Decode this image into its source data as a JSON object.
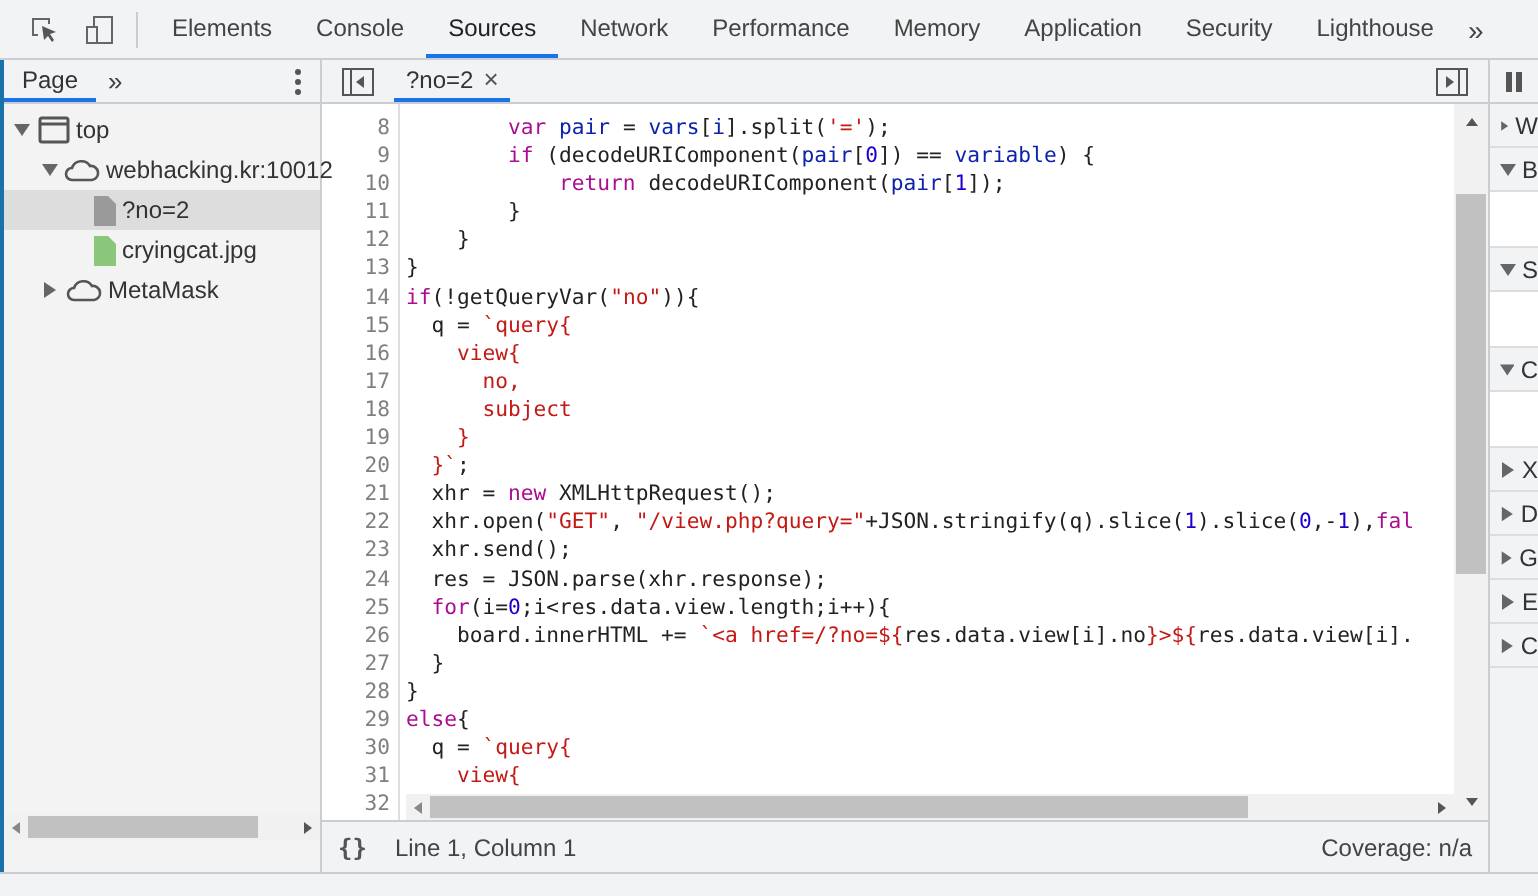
{
  "toolbar": {
    "tabs": [
      {
        "label": "Elements",
        "selected": false
      },
      {
        "label": "Console",
        "selected": false
      },
      {
        "label": "Sources",
        "selected": true
      },
      {
        "label": "Network",
        "selected": false
      },
      {
        "label": "Performance",
        "selected": false
      },
      {
        "label": "Memory",
        "selected": false
      },
      {
        "label": "Application",
        "selected": false
      },
      {
        "label": "Security",
        "selected": false
      },
      {
        "label": "Lighthouse",
        "selected": false
      }
    ],
    "more": "»"
  },
  "navigator": {
    "tabs": [
      {
        "label": "Page",
        "selected": true
      }
    ],
    "more": "»",
    "tree": [
      {
        "label": "top",
        "kind": "frame",
        "expanded": true,
        "selected": false,
        "children": [
          {
            "label": "webhacking.kr:10012",
            "kind": "cloud",
            "expanded": true,
            "selected": false,
            "children": [
              {
                "label": "?no=2",
                "kind": "doc",
                "selected": true
              },
              {
                "label": "cryingcat.jpg",
                "kind": "image",
                "selected": false
              }
            ]
          },
          {
            "label": "MetaMask",
            "kind": "cloud",
            "expanded": false,
            "selected": false
          }
        ]
      }
    ]
  },
  "editor": {
    "tabs": [
      {
        "label": "?no=2",
        "selected": true,
        "close": "×"
      }
    ],
    "lines": [
      {
        "n": "8",
        "tokens": [
          {
            "kind": "keyword",
            "text": "        var "
          },
          {
            "kind": "variable",
            "text": "pair"
          },
          {
            "kind": "plain",
            "text": " = "
          },
          {
            "kind": "variable",
            "text": "vars"
          },
          {
            "kind": "plain",
            "text": "["
          },
          {
            "kind": "variable",
            "text": "i"
          },
          {
            "kind": "plain",
            "text": "].split("
          },
          {
            "kind": "string",
            "text": "'='"
          },
          {
            "kind": "plain",
            "text": ");"
          }
        ]
      },
      {
        "n": "9",
        "tokens": [
          {
            "kind": "keyword",
            "text": "        if"
          },
          {
            "kind": "plain",
            "text": " (decodeURIComponent("
          },
          {
            "kind": "variable",
            "text": "pair"
          },
          {
            "kind": "plain",
            "text": "["
          },
          {
            "kind": "number",
            "text": "0"
          },
          {
            "kind": "plain",
            "text": "]) == "
          },
          {
            "kind": "variable",
            "text": "variable"
          },
          {
            "kind": "plain",
            "text": ") {"
          }
        ]
      },
      {
        "n": "10",
        "tokens": [
          {
            "kind": "keyword",
            "text": "            return"
          },
          {
            "kind": "plain",
            "text": " decodeURIComponent("
          },
          {
            "kind": "variable",
            "text": "pair"
          },
          {
            "kind": "plain",
            "text": "["
          },
          {
            "kind": "number",
            "text": "1"
          },
          {
            "kind": "plain",
            "text": "]);"
          }
        ]
      },
      {
        "n": "11",
        "tokens": [
          {
            "kind": "plain",
            "text": "        }"
          }
        ]
      },
      {
        "n": "12",
        "tokens": [
          {
            "kind": "plain",
            "text": "    }"
          }
        ]
      },
      {
        "n": "13",
        "tokens": [
          {
            "kind": "plain",
            "text": "}"
          }
        ]
      },
      {
        "n": "14",
        "tokens": [
          {
            "kind": "keyword",
            "text": "if"
          },
          {
            "kind": "plain",
            "text": "(!getQueryVar("
          },
          {
            "kind": "string",
            "text": "\"no\""
          },
          {
            "kind": "plain",
            "text": ")){"
          }
        ]
      },
      {
        "n": "15",
        "tokens": [
          {
            "kind": "plain",
            "text": "  q = "
          },
          {
            "kind": "string",
            "text": "`query{"
          }
        ]
      },
      {
        "n": "16",
        "tokens": [
          {
            "kind": "string",
            "text": "    view{"
          }
        ]
      },
      {
        "n": "17",
        "tokens": [
          {
            "kind": "string",
            "text": "      no,"
          }
        ]
      },
      {
        "n": "18",
        "tokens": [
          {
            "kind": "string",
            "text": "      subject"
          }
        ]
      },
      {
        "n": "19",
        "tokens": [
          {
            "kind": "string",
            "text": "    }"
          }
        ]
      },
      {
        "n": "20",
        "tokens": [
          {
            "kind": "string",
            "text": "  }`"
          },
          {
            "kind": "plain",
            "text": ";"
          }
        ]
      },
      {
        "n": "21",
        "tokens": [
          {
            "kind": "plain",
            "text": "  xhr = "
          },
          {
            "kind": "keyword",
            "text": "new"
          },
          {
            "kind": "plain",
            "text": " XMLHttpRequest();"
          }
        ]
      },
      {
        "n": "22",
        "tokens": [
          {
            "kind": "plain",
            "text": "  xhr.open("
          },
          {
            "kind": "string",
            "text": "\"GET\""
          },
          {
            "kind": "plain",
            "text": ", "
          },
          {
            "kind": "string",
            "text": "\"/view.php?query=\""
          },
          {
            "kind": "plain",
            "text": "+JSON.stringify(q).slice("
          },
          {
            "kind": "number",
            "text": "1"
          },
          {
            "kind": "plain",
            "text": ").slice("
          },
          {
            "kind": "number",
            "text": "0"
          },
          {
            "kind": "plain",
            "text": ",-"
          },
          {
            "kind": "number",
            "text": "1"
          },
          {
            "kind": "plain",
            "text": "),"
          },
          {
            "kind": "keyword",
            "text": "fal"
          }
        ]
      },
      {
        "n": "23",
        "tokens": [
          {
            "kind": "plain",
            "text": "  xhr.send();"
          }
        ]
      },
      {
        "n": "24",
        "tokens": [
          {
            "kind": "plain",
            "text": "  res = JSON.parse(xhr.response);"
          }
        ]
      },
      {
        "n": "25",
        "tokens": [
          {
            "kind": "keyword",
            "text": "  for"
          },
          {
            "kind": "plain",
            "text": "(i="
          },
          {
            "kind": "number",
            "text": "0"
          },
          {
            "kind": "plain",
            "text": ";i<res.data.view.length;i++){"
          }
        ]
      },
      {
        "n": "26",
        "tokens": [
          {
            "kind": "plain",
            "text": "    board.innerHTML += "
          },
          {
            "kind": "string",
            "text": "`<a href=/?no=${"
          },
          {
            "kind": "plain",
            "text": "res.data.view[i].no"
          },
          {
            "kind": "string",
            "text": "}>${"
          },
          {
            "kind": "plain",
            "text": "res.data.view[i]."
          }
        ]
      },
      {
        "n": "27",
        "tokens": [
          {
            "kind": "plain",
            "text": "  }"
          }
        ]
      },
      {
        "n": "28",
        "tokens": [
          {
            "kind": "plain",
            "text": "}"
          }
        ]
      },
      {
        "n": "29",
        "tokens": [
          {
            "kind": "keyword",
            "text": "else"
          },
          {
            "kind": "plain",
            "text": "{"
          }
        ]
      },
      {
        "n": "30",
        "tokens": [
          {
            "kind": "plain",
            "text": "  q = "
          },
          {
            "kind": "string",
            "text": "`query{"
          }
        ]
      },
      {
        "n": "31",
        "tokens": [
          {
            "kind": "string",
            "text": "    view{"
          }
        ]
      },
      {
        "n": "32"
      }
    ],
    "status": {
      "format": "{}",
      "position": "Line 1, Column 1",
      "coverage": "Coverage: n/a"
    }
  },
  "debugger": {
    "sections": [
      {
        "label": "W",
        "expanded": false
      },
      {
        "label": "B",
        "expanded": true
      },
      {
        "label": "S",
        "expanded": true
      },
      {
        "label": "C",
        "expanded": true
      },
      {
        "label": "X",
        "expanded": false
      },
      {
        "label": "D",
        "expanded": false
      },
      {
        "label": "G",
        "expanded": false
      },
      {
        "label": "E",
        "expanded": false
      },
      {
        "label": "C",
        "expanded": false
      }
    ]
  }
}
